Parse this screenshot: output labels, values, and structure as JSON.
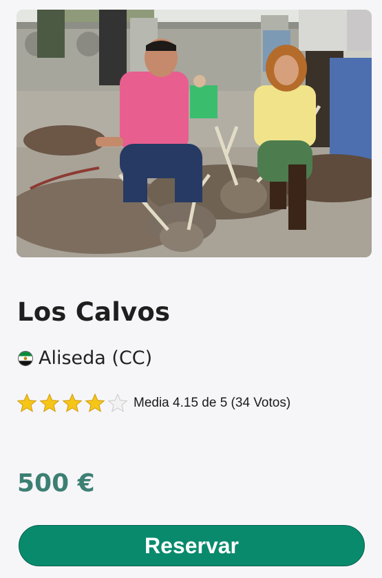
{
  "listing": {
    "title": "Los Calvos",
    "location": "Aliseda (CC)",
    "region_flag": "extremadura-flag-icon",
    "rating": {
      "value": 4.15,
      "max": 5,
      "stars_filled": 4,
      "text": "Media 4.15 de 5 (34 Votos)"
    },
    "price": "500 €",
    "reserve_label": "Reservar"
  },
  "colors": {
    "price": "#3d7f73",
    "button": "#098a6d",
    "star_filled": "#f5c518",
    "star_empty": "#f2f2f2"
  }
}
